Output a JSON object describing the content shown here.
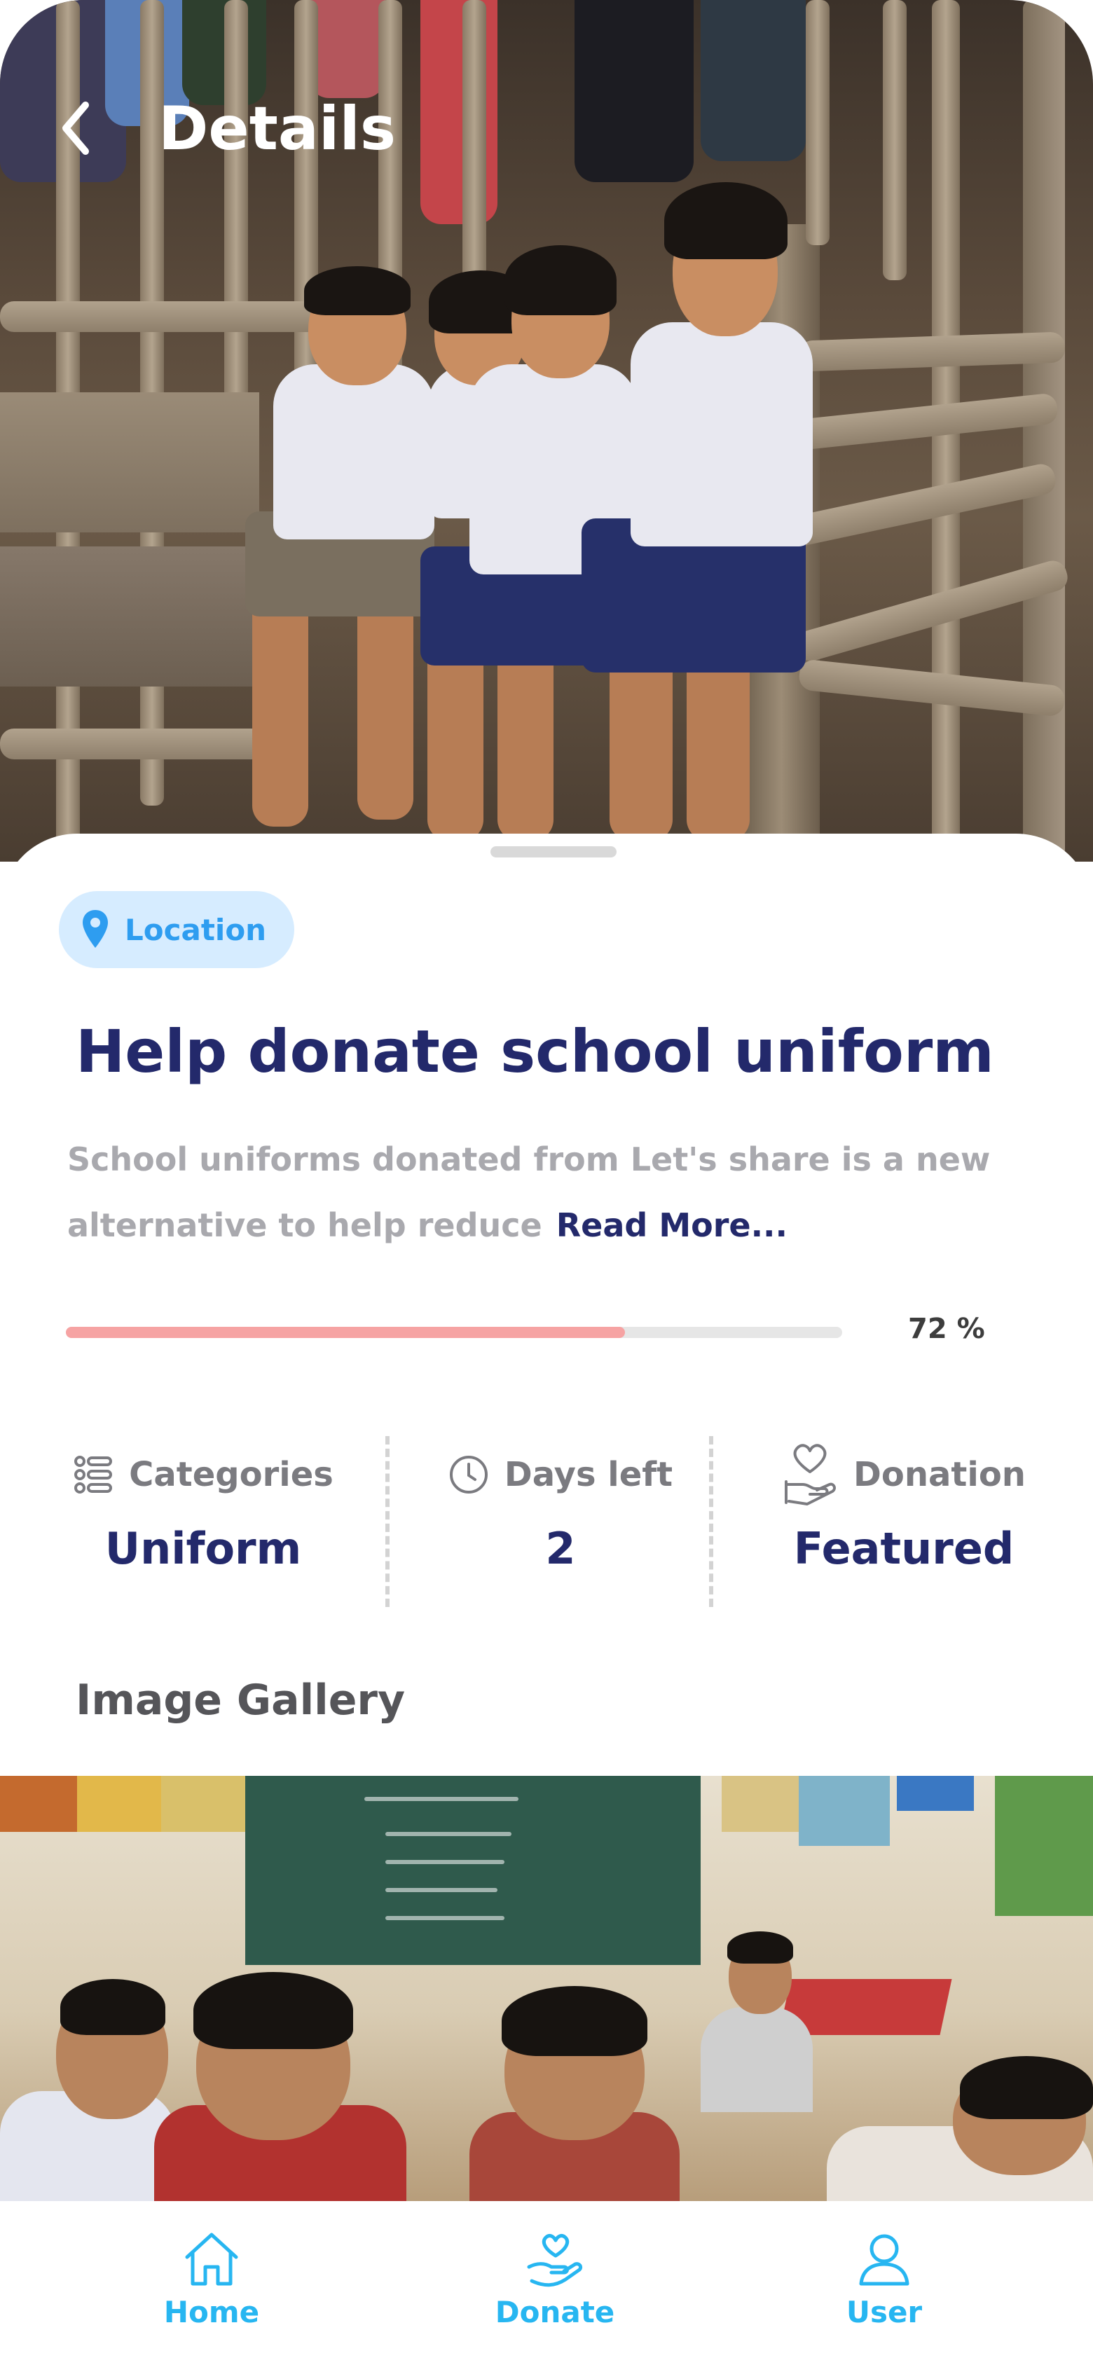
{
  "header": {
    "title": "Details"
  },
  "campaign": {
    "location_label": "Location",
    "title": "Help donate school uniform",
    "description": "School uniforms donated from Let's share is a new alternative to help reduce",
    "read_more": "Read More...",
    "progress": 0.72,
    "progress_label": "72 %"
  },
  "stats": [
    {
      "label": "Categories",
      "value": "Uniform",
      "icon": "list-icon"
    },
    {
      "label": "Days left",
      "value": "2",
      "icon": "clock-icon"
    },
    {
      "label": "Donation",
      "value": "Featured",
      "icon": "heart-hand-icon"
    }
  ],
  "gallery": {
    "title": "Image Gallery"
  },
  "nav": {
    "items": [
      {
        "label": "Home",
        "icon": "home-icon"
      },
      {
        "label": "Donate",
        "icon": "donate-icon"
      },
      {
        "label": "User",
        "icon": "user-icon"
      }
    ]
  },
  "colors": {
    "primary_text": "#23296b",
    "accent_blue": "#27b6f1",
    "chip_bg": "#d6ecff",
    "progress_fill": "#f6a3a3"
  }
}
